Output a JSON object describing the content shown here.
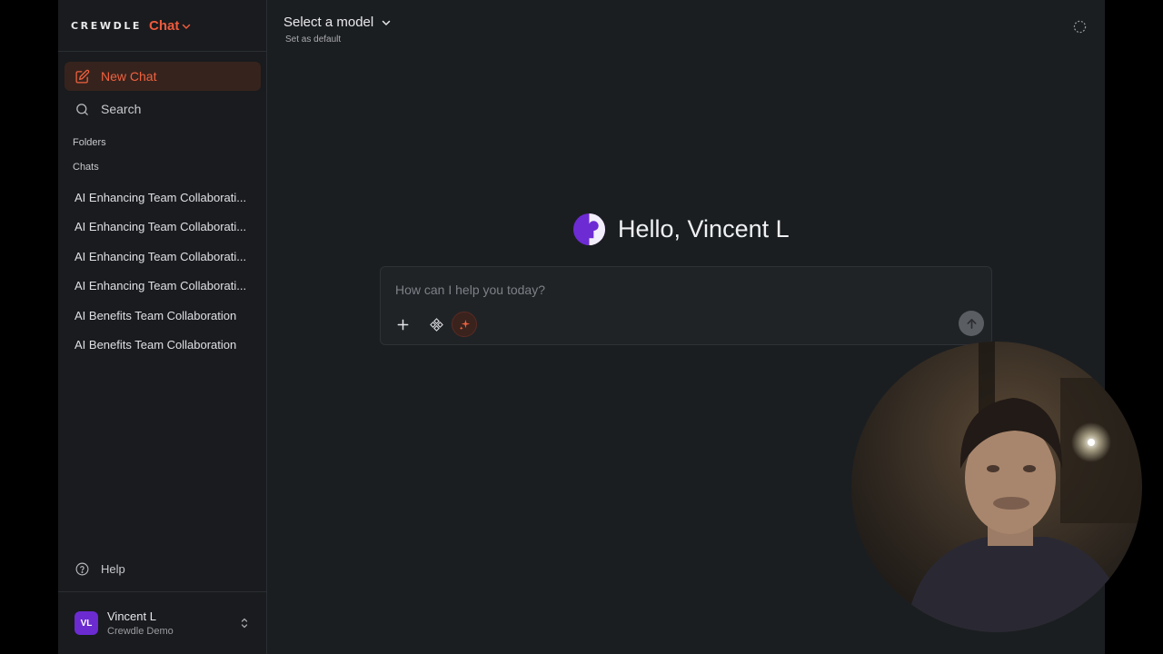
{
  "brand": {
    "wordmark": "CREWDLE",
    "product": "Chat"
  },
  "sidebar": {
    "new_chat": "New Chat",
    "search": "Search",
    "folders_label": "Folders",
    "chats_label": "Chats",
    "chats": [
      "AI Enhancing Team Collaborati...",
      "AI Enhancing Team Collaborati...",
      "AI Enhancing Team Collaborati...",
      "AI Enhancing Team Collaborati...",
      "AI Benefits Team Collaboration",
      "AI Benefits Team Collaboration"
    ],
    "help": "Help"
  },
  "user": {
    "initials": "VL",
    "name": "Vincent L",
    "org": "Crewdle Demo"
  },
  "header": {
    "model_select": "Select a model",
    "set_default": "Set as default"
  },
  "main": {
    "greeting": "Hello, Vincent L",
    "composer_placeholder": "How can I help you today?"
  },
  "colors": {
    "accent": "#ef5a3c",
    "avatar": "#6b2bd1",
    "background": "#1b1e21",
    "sidebar": "#191b1e"
  },
  "icons": {
    "new_chat": "edit-icon",
    "search": "search-icon",
    "help": "help-circle-icon",
    "plus": "plus-icon",
    "apps": "apps-icon",
    "spark": "sparkles-icon",
    "send": "arrow-up-icon",
    "spinner": "loading-icon",
    "model_chevron": "chevron-down-icon"
  }
}
